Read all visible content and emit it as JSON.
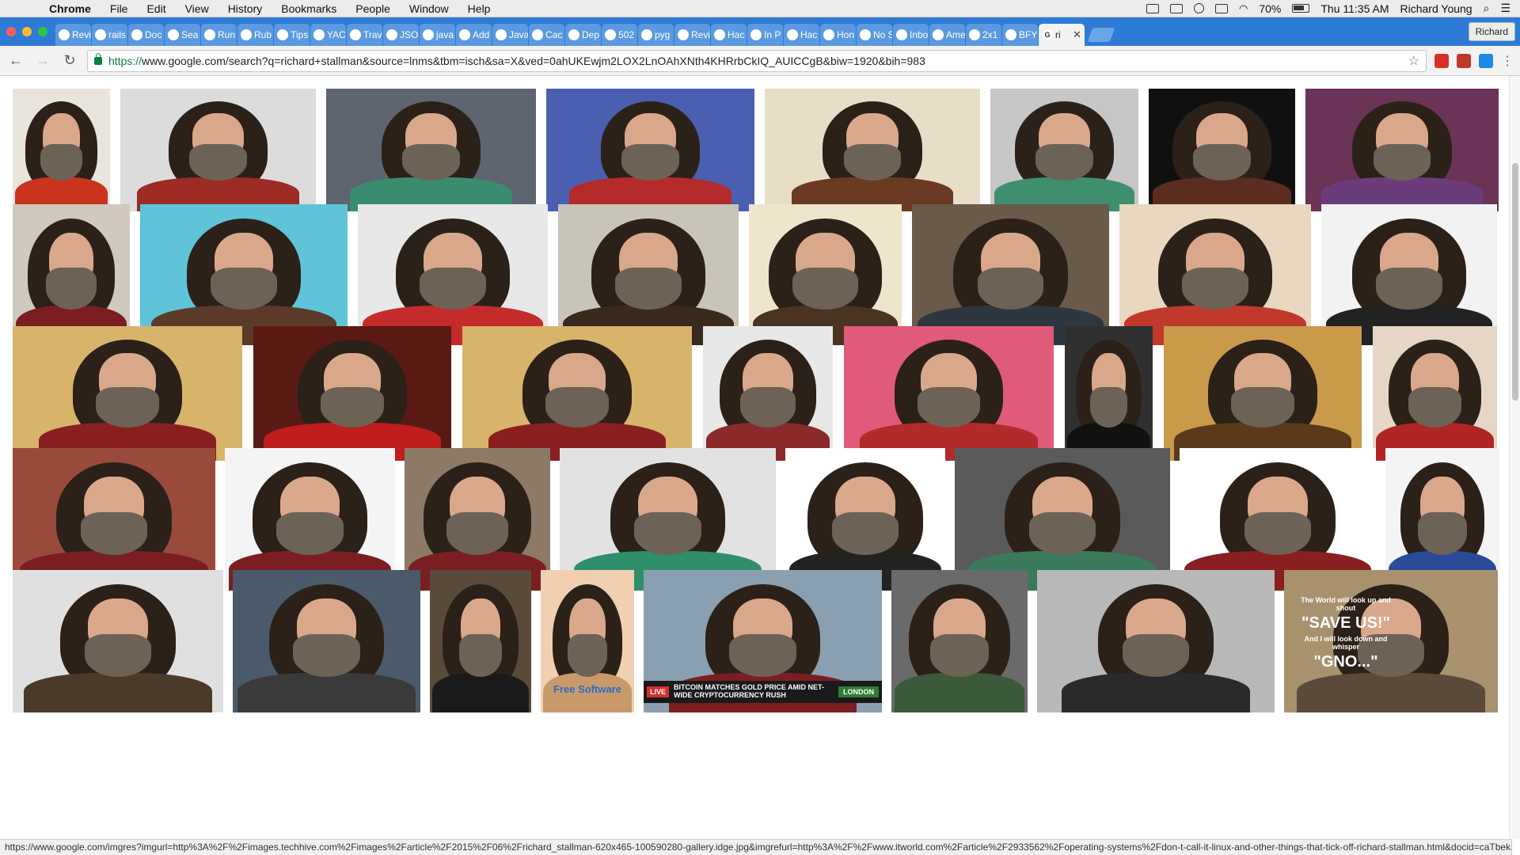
{
  "menubar": {
    "app_name": "Chrome",
    "items": [
      "File",
      "Edit",
      "View",
      "History",
      "Bookmarks",
      "People",
      "Window",
      "Help"
    ],
    "battery": "70%",
    "clock": "Thu 11:35 AM",
    "user": "Richard Young"
  },
  "tabs": [
    {
      "label": "Revi",
      "icon": "github-icon"
    },
    {
      "label": "rails",
      "icon": "github-icon"
    },
    {
      "label": "Doc",
      "icon": "doc-icon"
    },
    {
      "label": "Sea",
      "icon": "github-icon"
    },
    {
      "label": "Run",
      "icon": "run-icon"
    },
    {
      "label": "Rub",
      "icon": "ruby-icon"
    },
    {
      "label": "Tips",
      "icon": "tips-icon"
    },
    {
      "label": "YAC",
      "icon": "bing-icon"
    },
    {
      "label": "Trav",
      "icon": "travis-icon"
    },
    {
      "label": "JSO",
      "icon": "json-icon"
    },
    {
      "label": "java",
      "icon": "google-icon"
    },
    {
      "label": "Add",
      "icon": "wordpress-icon"
    },
    {
      "label": "Java",
      "icon": "wordpress-icon"
    },
    {
      "label": "Cac",
      "icon": "cache-icon"
    },
    {
      "label": "Dep",
      "icon": "deploy-icon"
    },
    {
      "label": "502",
      "icon": "page-icon"
    },
    {
      "label": "pyg",
      "icon": "pygame-icon"
    },
    {
      "label": "Revi",
      "icon": "github-icon"
    },
    {
      "label": "Hac",
      "icon": "hackernews-icon"
    },
    {
      "label": "In P",
      "icon": "hackernews-icon"
    },
    {
      "label": "Hac",
      "icon": "hackernews-icon"
    },
    {
      "label": "Hon",
      "icon": "hackernews-icon"
    },
    {
      "label": "No S",
      "icon": "github-icon"
    },
    {
      "label": "Inbo",
      "icon": "inbox-icon"
    },
    {
      "label": "Ame",
      "icon": "wikipedia-icon"
    },
    {
      "label": "2x1",
      "icon": "google-icon"
    },
    {
      "label": "BFY",
      "icon": "bfy-icon"
    }
  ],
  "active_tab": {
    "label": "ri",
    "close": "✕"
  },
  "profile_button": "Richard",
  "address_bar": {
    "scheme": "https://",
    "rest": "www.google.com/search?q=richard+stallman&source=lnms&tbm=isch&sa=X&ved=0ahUKEwjm2LOX2LnOAhXNth4KHRrbCkIQ_AUICCgB&biw=1920&bih=983"
  },
  "images": [
    {
      "shirt": "#c8341e",
      "bg": "#e9e4dc",
      "label": ""
    },
    {
      "shirt": "#9b2b24",
      "bg": "#dcdcdc",
      "label": ""
    },
    {
      "shirt": "#3a8c6e",
      "bg": "#5e6470",
      "label": ""
    },
    {
      "shirt": "#b52a2a",
      "bg": "#4a5fb0",
      "label": ""
    },
    {
      "shirt": "#6b3a22",
      "bg": "#e8ddc7",
      "label": ""
    },
    {
      "shirt": "#3f8f6f",
      "bg": "#c7c7c7",
      "label": ""
    },
    {
      "shirt": "#5a2d20",
      "bg": "#101010",
      "label": ""
    },
    {
      "shirt": "#6a3d7a",
      "bg": "#6b3355",
      "label": ""
    },
    {
      "shirt": "#7a1e22",
      "bg": "#cfc9c0",
      "label": ""
    },
    {
      "shirt": "#5b3a2a",
      "bg": "#5fc4d7",
      "label": ""
    },
    {
      "shirt": "#c42b2b",
      "bg": "#e8e8e8",
      "label": ""
    },
    {
      "shirt": "#3a2a1e",
      "bg": "#c9c4ba",
      "label": ""
    },
    {
      "shirt": "#4a3320",
      "bg": "#efe4cc",
      "label": ""
    },
    {
      "shirt": "#2e3640",
      "bg": "#6a5a4a",
      "label": ""
    },
    {
      "shirt": "#c0392b",
      "bg": "#ead7c0",
      "label": ""
    },
    {
      "shirt": "#222222",
      "bg": "#f2f2f2",
      "label": ""
    },
    {
      "shirt": "#8a1f1f",
      "bg": "#d8b36a",
      "label": ""
    },
    {
      "shirt": "#c01d1d",
      "bg": "#5a1a14",
      "label": ""
    },
    {
      "shirt": "#8a1f1f",
      "bg": "#d8b36a",
      "label": ""
    },
    {
      "shirt": "#8a2a2a",
      "bg": "#e8e8e8",
      "label": ""
    },
    {
      "shirt": "#b22a2a",
      "bg": "#e05a7a",
      "label": ""
    },
    {
      "shirt": "#111111",
      "bg": "#303030",
      "label": ""
    },
    {
      "shirt": "#5a3a1a",
      "bg": "#c99a4a",
      "label": ""
    },
    {
      "shirt": "#b12525",
      "bg": "#e6d6c6",
      "label": ""
    },
    {
      "shirt": "#7a1e22",
      "bg": "#9a4a3a",
      "label": ""
    },
    {
      "shirt": "#7a1e22",
      "bg": "#f4f4f4",
      "label": ""
    },
    {
      "shirt": "#7a1e22",
      "bg": "#8c7a66",
      "label": ""
    },
    {
      "shirt": "#2f8f6a",
      "bg": "#e2e2e2",
      "label": ""
    },
    {
      "shirt": "#222222",
      "bg": "#ffffff",
      "label": ""
    },
    {
      "shirt": "#3a7a5a",
      "bg": "#5a5a5a",
      "label": ""
    },
    {
      "shirt": "#8a1f1f",
      "bg": "#ffffff",
      "label": ""
    },
    {
      "shirt": "#2a4a9a",
      "bg": "#f4f4f4",
      "label": ""
    },
    {
      "shirt": "#4a3a2a",
      "bg": "#e0e0e0",
      "label": ""
    },
    {
      "shirt": "#3a3a3a",
      "bg": "#4a5a6a",
      "label": ""
    },
    {
      "shirt": "#1a1a1a",
      "bg": "#5a4a3a",
      "label": ""
    },
    {
      "shirt": "#c89a6a",
      "bg": "#f0d0b0",
      "label": "Free Software"
    },
    {
      "shirt": "#7a1e22",
      "bg": "#8aa0b0",
      "label": ""
    },
    {
      "shirt": "#3a5a3a",
      "bg": "#6a6a6a",
      "label": ""
    },
    {
      "shirt": "#2a2a2a",
      "bg": "#b8b8b8",
      "label": ""
    },
    {
      "shirt": "#5a4a3a",
      "bg": "#a8926e",
      "label": ""
    }
  ],
  "overlays": {
    "bitcoin_headline": "BITCOIN MATCHES GOLD PRICE AMID NET-WIDE CRYPTOCURRENCY RUSH",
    "live": "LIVE",
    "london": "LONDON",
    "quote_top": "The World will look up and shout",
    "quote_save": "\"SAVE US!\"",
    "quote_mid": "And I will look down and whisper",
    "quote_gno": "\"GNO...\""
  },
  "status_url": "https://www.google.com/imgres?imgurl=http%3A%2F%2Fimages.techhive.com%2Fimages%2Farticle%2F2015%2F06%2Frichard_stallman-620x465-100590280-gallery.idge.jpg&imgrefurl=http%3A%2F%2Fwww.itworld.com%2Farticle%2F2933562%2Foperating-systems%2Fdon-t-call-it-linux-and-other-things-that-tick-off-richard-stallman.html&docid=caTbekJ..."
}
